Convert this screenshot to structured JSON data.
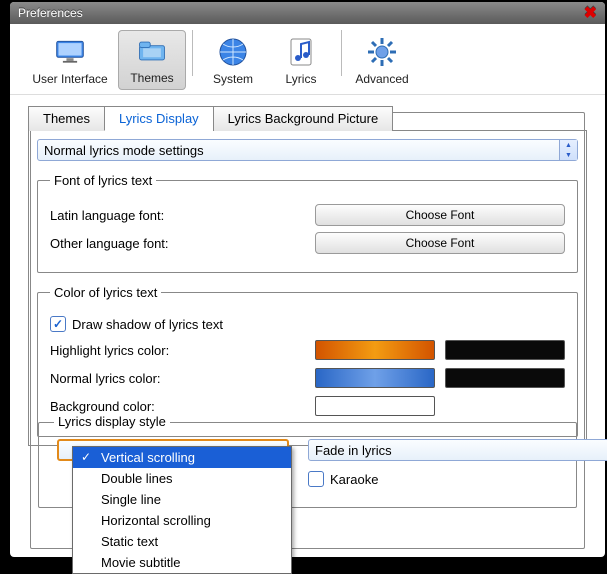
{
  "title": "Preferences",
  "toolbar": [
    {
      "label": "User Interface",
      "icon": "monitor"
    },
    {
      "label": "Themes",
      "icon": "folder",
      "selected": true
    },
    {
      "label": "System",
      "icon": "globe"
    },
    {
      "label": "Lyrics",
      "icon": "note"
    },
    {
      "label": "Advanced",
      "icon": "gear"
    }
  ],
  "tabs": {
    "items": [
      "Themes",
      "Lyrics Display",
      "Lyrics Background Picture"
    ],
    "active": 1
  },
  "mode_combo": "Normal lyrics mode settings",
  "font_section": {
    "legend": "Font of lyrics text",
    "rows": [
      {
        "label": "Latin language font:",
        "button": "Choose Font"
      },
      {
        "label": "Other language font:",
        "button": "Choose Font"
      }
    ]
  },
  "color_section": {
    "legend": "Color of lyrics text",
    "checkbox": "Draw shadow of lyrics text",
    "rows": [
      {
        "label": "Highlight lyrics color:"
      },
      {
        "label": "Normal lyrics color:"
      },
      {
        "label": "Background color:"
      }
    ]
  },
  "display_section": {
    "legend": "Lyrics display style",
    "scroll_combo_options": [
      "Vertical scrolling",
      "Double lines",
      "Single line",
      "Horizontal scrolling",
      "Static text",
      "Movie subtitle"
    ],
    "scroll_combo_selected": 0,
    "fade_combo": "Fade in lyrics",
    "karaoke_label": "Karaoke"
  }
}
